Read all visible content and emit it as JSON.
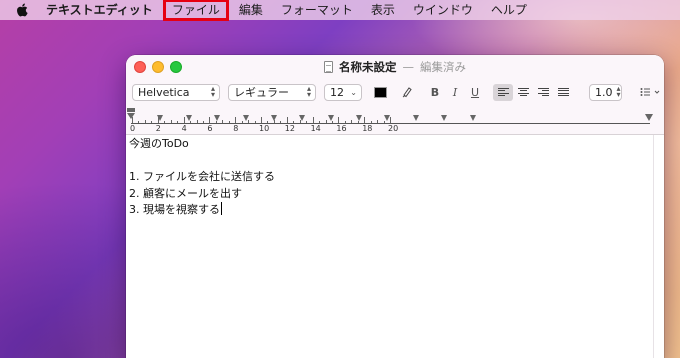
{
  "menubar": {
    "app_name": "テキストエディット",
    "items": [
      "ファイル",
      "編集",
      "フォーマット",
      "表示",
      "ウインドウ",
      "ヘルプ"
    ]
  },
  "window": {
    "title": "名称未設定",
    "separator": "—",
    "status": "編集済み"
  },
  "toolbar": {
    "font_family": "Helvetica",
    "font_style": "レギュラー",
    "font_size": "12",
    "bold": "B",
    "italic": "I",
    "underline": "U",
    "line_spacing": "1.0"
  },
  "ruler": {
    "labels": [
      "0",
      "2",
      "4",
      "6",
      "8",
      "10",
      "12",
      "14",
      "16",
      "18",
      "20"
    ]
  },
  "document": {
    "lines": [
      "今週のToDo",
      "",
      "1. ファイルを会社に送信する",
      "2. 顧客にメールを出す",
      "3. 現場を視察する"
    ]
  },
  "colors": {
    "highlight_box": "#e60012",
    "text_color_swatch": "#000000"
  },
  "icons": {
    "apple": "apple-icon",
    "document": "document-icon",
    "highlight": "highlight-pen-icon",
    "list": "list-bullets-icon"
  }
}
